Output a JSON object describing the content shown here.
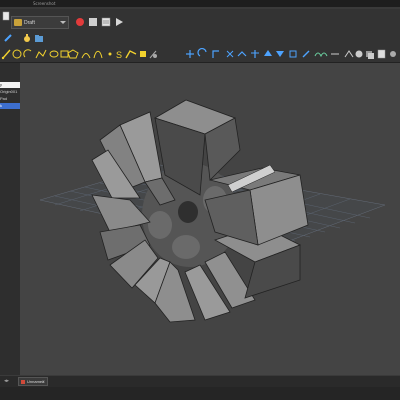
{
  "window": {
    "title": "Screenshot"
  },
  "toolbar": {
    "workbench": "Draft",
    "record_macro": "record-macro-icon",
    "stop_macro": "stop-macro-icon",
    "macros": "macros-icon",
    "execute_macro": "execute-macro-icon"
  },
  "tree": {
    "items": [
      {
        "label": "y"
      },
      {
        "label": "Origin001"
      },
      {
        "label": "Pad"
      },
      {
        "label": "k"
      }
    ]
  },
  "tabs": {
    "document_tab": "Unnamed",
    "close": "×",
    "arrows": "◂▸"
  },
  "colors": {
    "accent_selection": "#3d6fcf",
    "viewport_background": "#444444",
    "model_face_light": "#8e8e8e",
    "model_face_dark": "#4a4a4a",
    "record_red": "#e23b3b"
  }
}
